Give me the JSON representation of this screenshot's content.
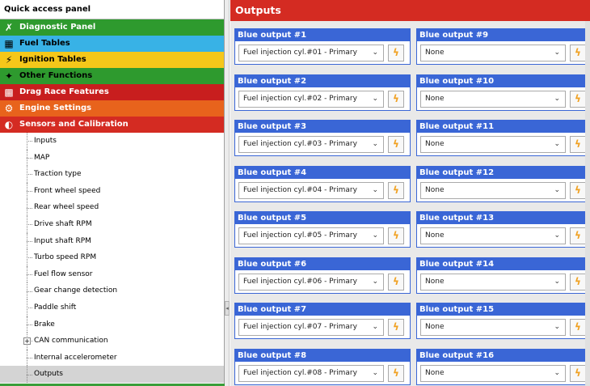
{
  "sidebar": {
    "header": "Quick access panel",
    "categories": [
      {
        "label": "Diagnostic Panel",
        "color": "#2e9a2e",
        "text_color": "#ffffff",
        "icon": "diagnostic-icon",
        "glyph": "✗"
      },
      {
        "label": "Fuel Tables",
        "color": "#38b2e6",
        "text_color": "#000000",
        "icon": "fuel-tables-icon",
        "glyph": "▦"
      },
      {
        "label": "Ignition Tables",
        "color": "#f5c71a",
        "text_color": "#000000",
        "icon": "ignition-tables-icon",
        "glyph": "⚡"
      },
      {
        "label": "Other Functions",
        "color": "#2e9a2e",
        "text_color": "#000000",
        "icon": "other-functions-icon",
        "glyph": "✦"
      },
      {
        "label": "Drag Race Features",
        "color": "#c81e1e",
        "text_color": "#ffffff",
        "icon": "drag-race-icon",
        "glyph": "▩"
      },
      {
        "label": "Engine Settings",
        "color": "#e8631c",
        "text_color": "#ffffff",
        "icon": "engine-settings-icon",
        "glyph": "⚙"
      },
      {
        "label": "Sensors and Calibration",
        "color": "#d42b22",
        "text_color": "#ffffff",
        "icon": "sensors-icon",
        "glyph": "◐"
      }
    ],
    "items": [
      {
        "label": "Inputs"
      },
      {
        "label": "MAP"
      },
      {
        "label": "Traction type"
      },
      {
        "label": "Front wheel speed"
      },
      {
        "label": "Rear wheel speed"
      },
      {
        "label": "Drive shaft RPM"
      },
      {
        "label": "Input shaft RPM"
      },
      {
        "label": "Turbo speed RPM"
      },
      {
        "label": "Fuel flow sensor"
      },
      {
        "label": "Gear change detection"
      },
      {
        "label": "Paddle shift"
      },
      {
        "label": "Brake"
      },
      {
        "label": "CAN communication",
        "expander": "+"
      },
      {
        "label": "Internal accelerometer"
      },
      {
        "label": "Outputs",
        "selected": true
      }
    ]
  },
  "main": {
    "title": "Outputs",
    "outputs_left": [
      {
        "title": "Blue output #1",
        "value": "Fuel injection cyl.#01 - Primary"
      },
      {
        "title": "Blue output #2",
        "value": "Fuel injection cyl.#02 - Primary"
      },
      {
        "title": "Blue output #3",
        "value": "Fuel injection cyl.#03 - Primary"
      },
      {
        "title": "Blue output #4",
        "value": "Fuel injection cyl.#04 - Primary"
      },
      {
        "title": "Blue output #5",
        "value": "Fuel injection cyl.#05 - Primary"
      },
      {
        "title": "Blue output #6",
        "value": "Fuel injection cyl.#06 - Primary"
      },
      {
        "title": "Blue output #7",
        "value": "Fuel injection cyl.#07 - Primary"
      },
      {
        "title": "Blue output #8",
        "value": "Fuel injection cyl.#08 - Primary"
      }
    ],
    "outputs_right": [
      {
        "title": "Blue output #9",
        "value": "None"
      },
      {
        "title": "Blue output #10",
        "value": "None"
      },
      {
        "title": "Blue output #11",
        "value": "None"
      },
      {
        "title": "Blue output #12",
        "value": "None"
      },
      {
        "title": "Blue output #13",
        "value": "None"
      },
      {
        "title": "Blue output #14",
        "value": "None"
      },
      {
        "title": "Blue output #15",
        "value": "None"
      },
      {
        "title": "Blue output #16",
        "value": "None"
      }
    ],
    "accent_color": "#3a66d6",
    "bolt_icon": "lightning-icon"
  }
}
